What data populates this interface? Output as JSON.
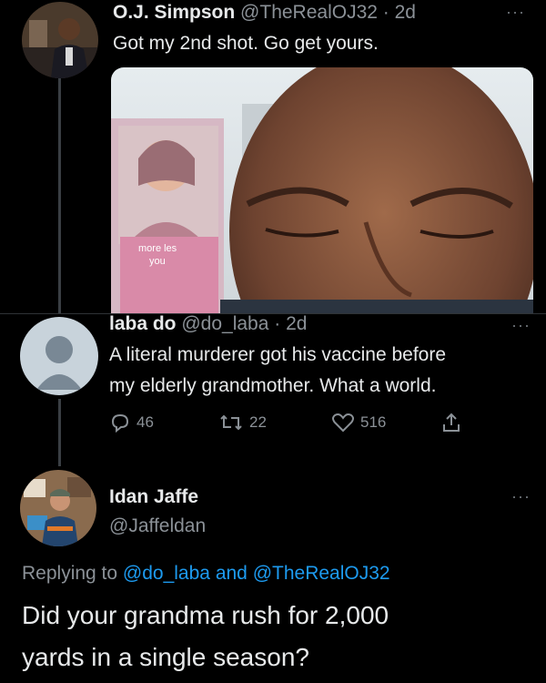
{
  "tweet1": {
    "display_name": "O.J. Simpson",
    "handle": "@TheRealOJ32",
    "time": "· 2d",
    "text": "Got my 2nd shot. Go get yours.",
    "media": {
      "sign_line1": "more les",
      "sign_line2": "you"
    }
  },
  "tweet2": {
    "display_name": "laba do",
    "handle": "@do_laba",
    "time": "· 2d",
    "text_line1": "A literal murderer got his vaccine before",
    "text_line2": "my elderly grandmother. What a world.",
    "replies": "46",
    "retweets": "22",
    "likes": "516"
  },
  "tweet3": {
    "display_name": "Idan Jaffe",
    "handle": "@Jaffeldan",
    "replying_prefix": "Replying to",
    "replying_user1": "@do_laba",
    "replying_and": "and",
    "replying_user2": "@TheRealOJ32",
    "text_line1": "Did your grandma rush for 2,000",
    "text_line2": "yards in a single season?"
  },
  "more_glyph": "···",
  "colors": {
    "background": "#000000",
    "primary_text": "#e7e9ea",
    "secondary_text": "#8b9197",
    "accent": "#1d9bf0",
    "thread_line": "#3a3f44"
  }
}
